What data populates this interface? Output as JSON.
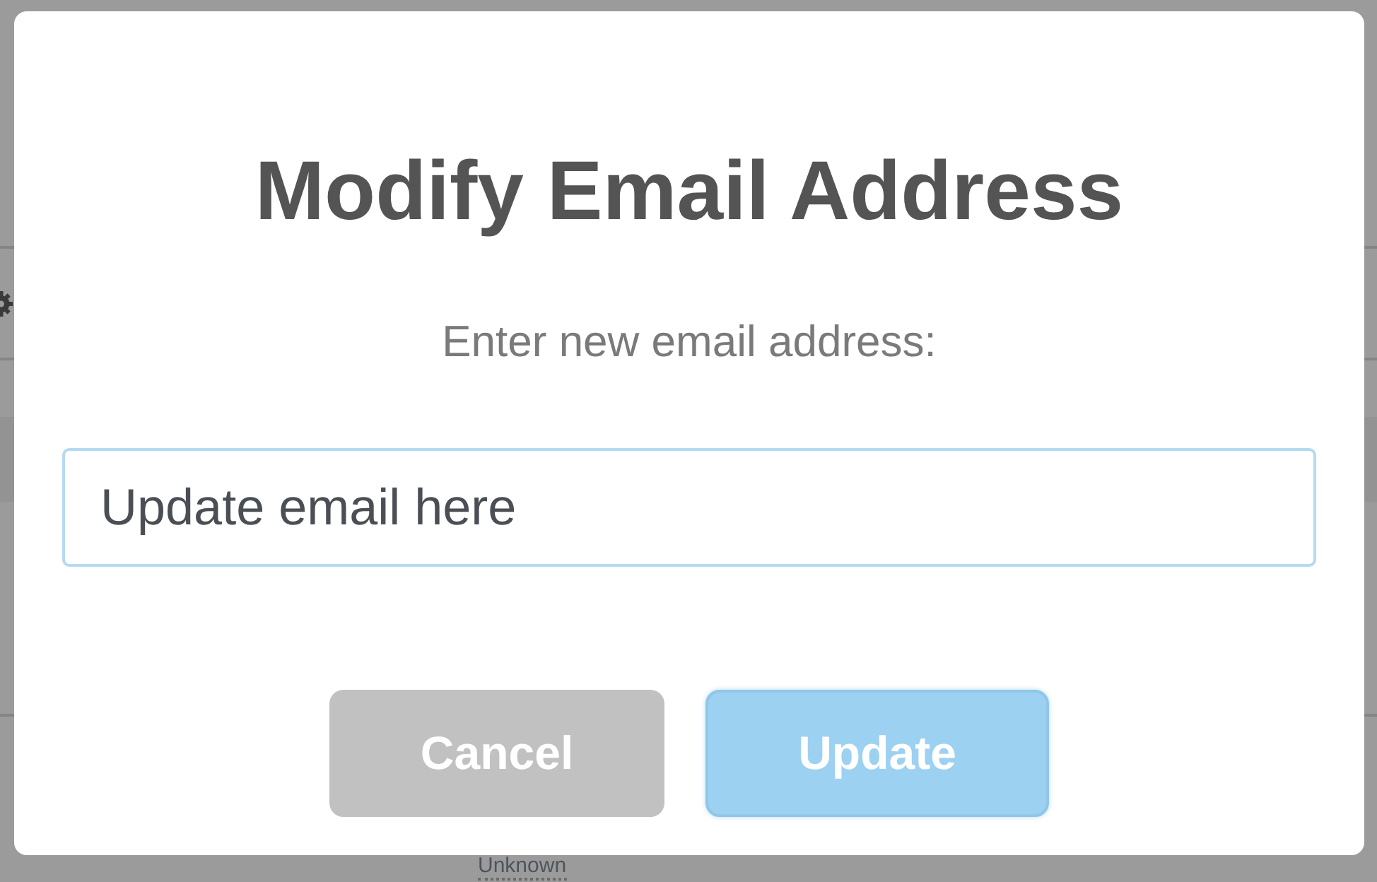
{
  "background": {
    "footer_text": "Unknown"
  },
  "dialog": {
    "title": "Modify Email Address",
    "prompt": "Enter new email address:",
    "email_field": {
      "value": "Update email here"
    },
    "buttons": [
      {
        "label": "Cancel",
        "kind": "cancel"
      },
      {
        "label": "Update",
        "kind": "confirm"
      }
    ]
  }
}
